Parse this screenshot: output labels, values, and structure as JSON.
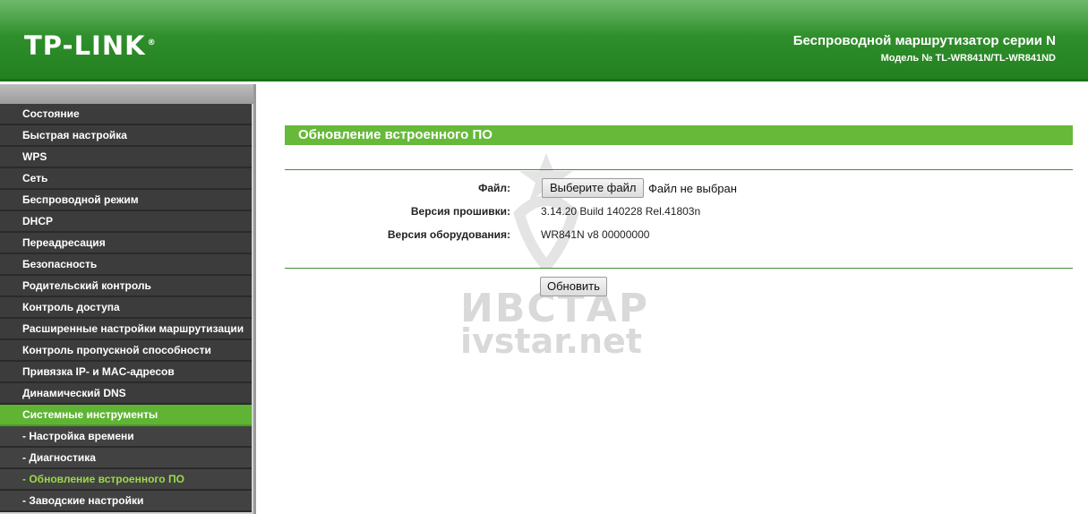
{
  "header": {
    "logo": "TP-LINK",
    "logo_mark": "®",
    "product_title": "Беспроводной маршрутизатор серии N",
    "model_line": "Модель № TL-WR841N/TL-WR841ND"
  },
  "sidebar": {
    "items": [
      {
        "label": "Состояние"
      },
      {
        "label": "Быстрая настройка"
      },
      {
        "label": "WPS"
      },
      {
        "label": "Сеть"
      },
      {
        "label": "Беспроводной режим"
      },
      {
        "label": "DHCP"
      },
      {
        "label": "Переадресация"
      },
      {
        "label": "Безопасность"
      },
      {
        "label": "Родительский контроль"
      },
      {
        "label": "Контроль доступа"
      },
      {
        "label": "Расширенные настройки маршрутизации"
      },
      {
        "label": "Контроль пропускной способности"
      },
      {
        "label": "Привязка IP- и MAC-адресов"
      },
      {
        "label": "Динамический DNS"
      },
      {
        "label": "Системные инструменты"
      },
      {
        "label": "- Настройка времени"
      },
      {
        "label": "- Диагностика"
      },
      {
        "label": "- Обновление встроенного ПО"
      },
      {
        "label": "- Заводские настройки"
      }
    ]
  },
  "main": {
    "title": "Обновление встроенного ПО",
    "file_label": "Файл:",
    "file_button": "Выберите файл",
    "file_status": "Файл не выбран",
    "firmware_label": "Версия прошивки:",
    "firmware_value": "3.14.20 Build 140228 Rel.41803n",
    "hardware_label": "Версия оборудования:",
    "hardware_value": "WR841N v8 00000000",
    "upgrade_button": "Обновить"
  },
  "watermark": {
    "line1": "ИВСТАР",
    "line2": "ivstar.net"
  },
  "colors": {
    "header_green": "#2f8f2c",
    "title_green": "#67b93a",
    "menu_dark": "#3c3c3c",
    "menu_active": "#5fb434"
  }
}
